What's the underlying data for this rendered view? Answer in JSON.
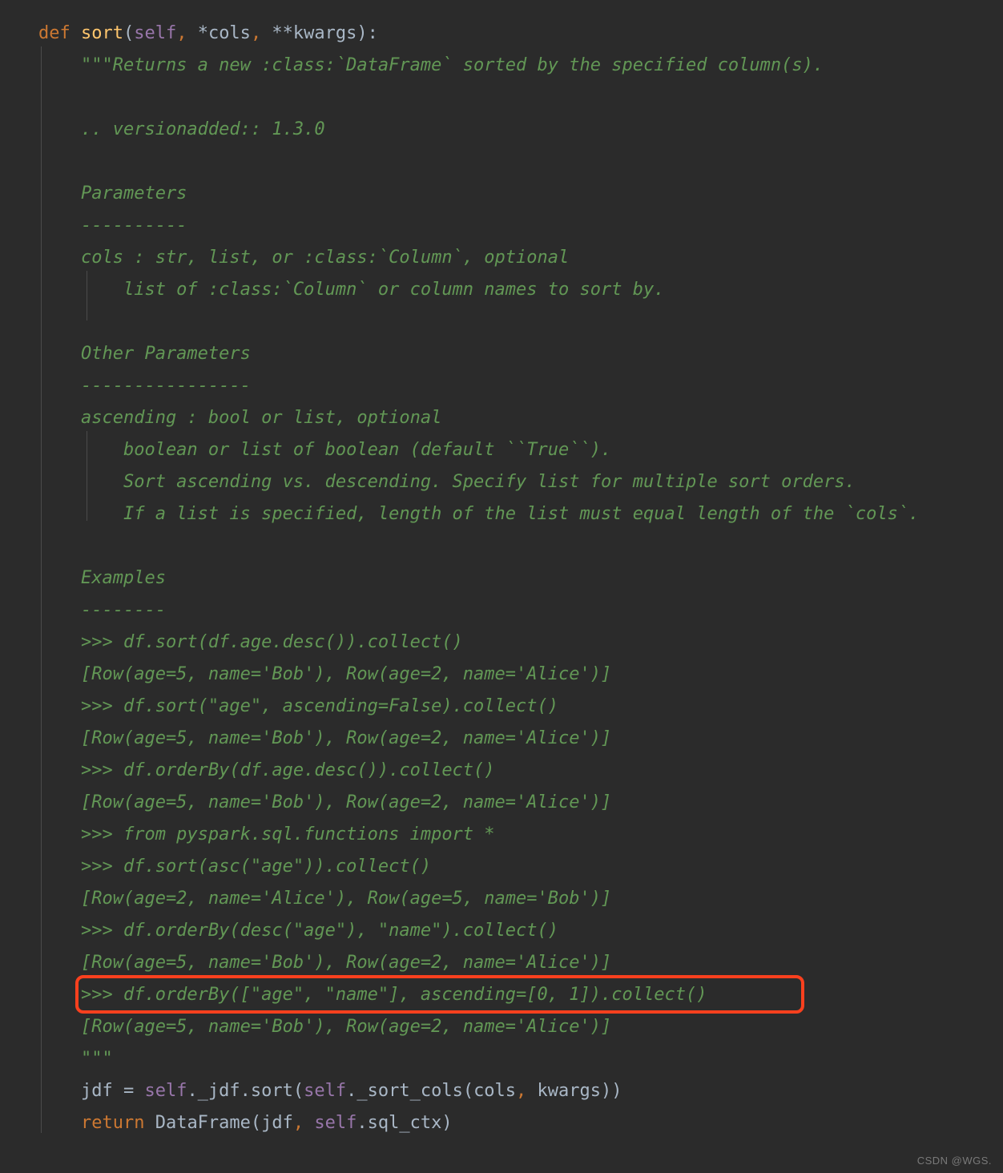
{
  "editor": {
    "theme": "darcula",
    "background_color": "#2b2b2b",
    "language": "python",
    "colors": {
      "keyword": "#cc7832",
      "function_name": "#ffc66d",
      "self_keyword": "#9876aa",
      "identifier": "#a9b7c6",
      "docstring": "#629755",
      "comma": "#cc7832",
      "indent_guide": "#4b4b4b",
      "highlight_border": "#f9401e"
    }
  },
  "highlight": {
    "shape": "rounded-rectangle",
    "target_line_index": 29,
    "target_text": ">>> df.orderBy([\"age\", \"name\"], ascending=[0, 1]).collect()"
  },
  "watermark": {
    "text": "CSDN @WGS."
  },
  "code": {
    "lines": [
      {
        "indent": 0,
        "tokens": [
          {
            "t": "def ",
            "c": "kw"
          },
          {
            "t": "sort",
            "c": "fn"
          },
          {
            "t": "(",
            "c": "punc"
          },
          {
            "t": "self",
            "c": "self"
          },
          {
            "t": ",",
            "c": "comma"
          },
          {
            "t": " *cols",
            "c": "ident"
          },
          {
            "t": ",",
            "c": "comma"
          },
          {
            "t": " **kwargs",
            "c": "ident"
          },
          {
            "t": "):",
            "c": "punc"
          }
        ]
      },
      {
        "indent": 4,
        "tokens": [
          {
            "t": "\"\"\"Returns a new :class:`DataFrame` sorted by the specified column(s).",
            "c": "doc"
          }
        ]
      },
      {
        "indent": 4,
        "tokens": []
      },
      {
        "indent": 4,
        "tokens": [
          {
            "t": ".. versionadded:: 1.3.0",
            "c": "doc"
          }
        ]
      },
      {
        "indent": 4,
        "tokens": []
      },
      {
        "indent": 4,
        "tokens": [
          {
            "t": "Parameters",
            "c": "doc"
          }
        ]
      },
      {
        "indent": 4,
        "tokens": [
          {
            "t": "----------",
            "c": "doc"
          }
        ]
      },
      {
        "indent": 4,
        "tokens": [
          {
            "t": "cols : str, list, or :class:`Column`, optional",
            "c": "doc"
          }
        ]
      },
      {
        "indent": 4,
        "tokens": [
          {
            "t": "    list of :class:`Column` or column names to sort by.",
            "c": "doc"
          }
        ]
      },
      {
        "indent": 4,
        "tokens": []
      },
      {
        "indent": 4,
        "tokens": [
          {
            "t": "Other Parameters",
            "c": "doc"
          }
        ]
      },
      {
        "indent": 4,
        "tokens": [
          {
            "t": "----------------",
            "c": "doc"
          }
        ]
      },
      {
        "indent": 4,
        "tokens": [
          {
            "t": "ascending : bool or list, optional",
            "c": "doc"
          }
        ]
      },
      {
        "indent": 4,
        "tokens": [
          {
            "t": "    boolean or list of boolean (default ``True``).",
            "c": "doc"
          }
        ]
      },
      {
        "indent": 4,
        "tokens": [
          {
            "t": "    Sort ascending vs. descending. Specify list for multiple sort orders.",
            "c": "doc"
          }
        ]
      },
      {
        "indent": 4,
        "tokens": [
          {
            "t": "    If a list is specified, length of the list must equal length of the `cols`.",
            "c": "doc"
          }
        ]
      },
      {
        "indent": 4,
        "tokens": []
      },
      {
        "indent": 4,
        "tokens": [
          {
            "t": "Examples",
            "c": "doc"
          }
        ]
      },
      {
        "indent": 4,
        "tokens": [
          {
            "t": "--------",
            "c": "doc"
          }
        ]
      },
      {
        "indent": 4,
        "tokens": [
          {
            "t": ">>> df.sort(df.age.desc()).collect()",
            "c": "doc"
          }
        ]
      },
      {
        "indent": 4,
        "tokens": [
          {
            "t": "[Row(age=5, name='Bob'), Row(age=2, name='Alice')]",
            "c": "doc"
          }
        ]
      },
      {
        "indent": 4,
        "tokens": [
          {
            "t": ">>> df.sort(\"age\", ascending=False).collect()",
            "c": "doc"
          }
        ]
      },
      {
        "indent": 4,
        "tokens": [
          {
            "t": "[Row(age=5, name='Bob'), Row(age=2, name='Alice')]",
            "c": "doc"
          }
        ]
      },
      {
        "indent": 4,
        "tokens": [
          {
            "t": ">>> df.orderBy(df.age.desc()).collect()",
            "c": "doc"
          }
        ]
      },
      {
        "indent": 4,
        "tokens": [
          {
            "t": "[Row(age=5, name='Bob'), Row(age=2, name='Alice')]",
            "c": "doc"
          }
        ]
      },
      {
        "indent": 4,
        "tokens": [
          {
            "t": ">>> from pyspark.sql.functions import *",
            "c": "doc"
          }
        ]
      },
      {
        "indent": 4,
        "tokens": [
          {
            "t": ">>> df.sort(asc(\"age\")).collect()",
            "c": "doc"
          }
        ]
      },
      {
        "indent": 4,
        "tokens": [
          {
            "t": "[Row(age=2, name='Alice'), Row(age=5, name='Bob')]",
            "c": "doc"
          }
        ]
      },
      {
        "indent": 4,
        "tokens": [
          {
            "t": ">>> df.orderBy(desc(\"age\"), \"name\").collect()",
            "c": "doc"
          }
        ]
      },
      {
        "indent": 4,
        "tokens": [
          {
            "t": "[Row(age=5, name='Bob'), Row(age=2, name='Alice')]",
            "c": "doc"
          }
        ]
      },
      {
        "indent": 4,
        "tokens": [
          {
            "t": ">>> df.orderBy([\"age\", \"name\"], ascending=[0, 1]).collect()",
            "c": "doc"
          }
        ]
      },
      {
        "indent": 4,
        "tokens": [
          {
            "t": "[Row(age=5, name='Bob'), Row(age=2, name='Alice')]",
            "c": "doc"
          }
        ]
      },
      {
        "indent": 4,
        "tokens": [
          {
            "t": "\"\"\"",
            "c": "doc"
          }
        ]
      },
      {
        "indent": 4,
        "tokens": [
          {
            "t": "jdf = ",
            "c": "ident"
          },
          {
            "t": "self",
            "c": "self"
          },
          {
            "t": "._jdf.sort(",
            "c": "ident"
          },
          {
            "t": "self",
            "c": "self"
          },
          {
            "t": "._sort_cols(cols",
            "c": "ident"
          },
          {
            "t": ",",
            "c": "comma"
          },
          {
            "t": " kwargs))",
            "c": "ident"
          }
        ]
      },
      {
        "indent": 4,
        "tokens": [
          {
            "t": "return ",
            "c": "kw"
          },
          {
            "t": "DataFrame(jdf",
            "c": "ident"
          },
          {
            "t": ",",
            "c": "comma"
          },
          {
            "t": " ",
            "c": "ident"
          },
          {
            "t": "self",
            "c": "self"
          },
          {
            "t": ".sql_ctx)",
            "c": "ident"
          }
        ]
      }
    ]
  }
}
